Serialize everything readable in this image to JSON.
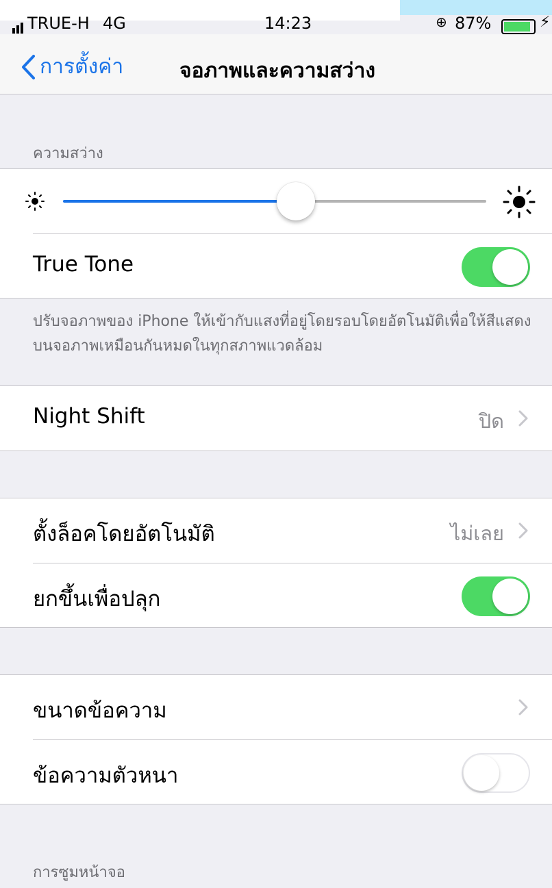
{
  "status_bar": {
    "carrier": "TRUE-H",
    "network": "4G",
    "time": "14:23",
    "battery_percent": "87%",
    "battery_level": 0.87
  },
  "nav": {
    "back_label": "การตั้งค่า",
    "title": "จอภาพและความสว่าง"
  },
  "brightness": {
    "header": "ความสว่าง",
    "level": 0.55,
    "low_icon": "sun-small-icon",
    "high_icon": "sun-large-icon"
  },
  "true_tone": {
    "label": "True Tone",
    "enabled": true,
    "footer": "ปรับจอภาพของ iPhone ให้เข้ากับแสงที่อยู่โดยรอบโดยอัตโนมัติเพื่อให้สีแสดงบนจอภาพเหมือนกันหมดในทุกสภาพแวดล้อม"
  },
  "night_shift": {
    "label": "Night Shift",
    "value": "ปิด"
  },
  "auto_lock": {
    "label": "ตั้งล็อคโดยอัตโนมัติ",
    "value": "ไม่เลย"
  },
  "raise_to_wake": {
    "label": "ยกขึ้นเพื่อปลุก",
    "enabled": true
  },
  "text_size": {
    "label": "ขนาดข้อความ"
  },
  "bold_text": {
    "label": "ข้อความตัวหนา",
    "enabled": false
  },
  "display_zoom": {
    "header": "การซูมหน้าจอ"
  },
  "colors": {
    "accent": "#1a73e8",
    "toggle_on": "#4cd964",
    "secondary_text": "#8e8e93"
  }
}
